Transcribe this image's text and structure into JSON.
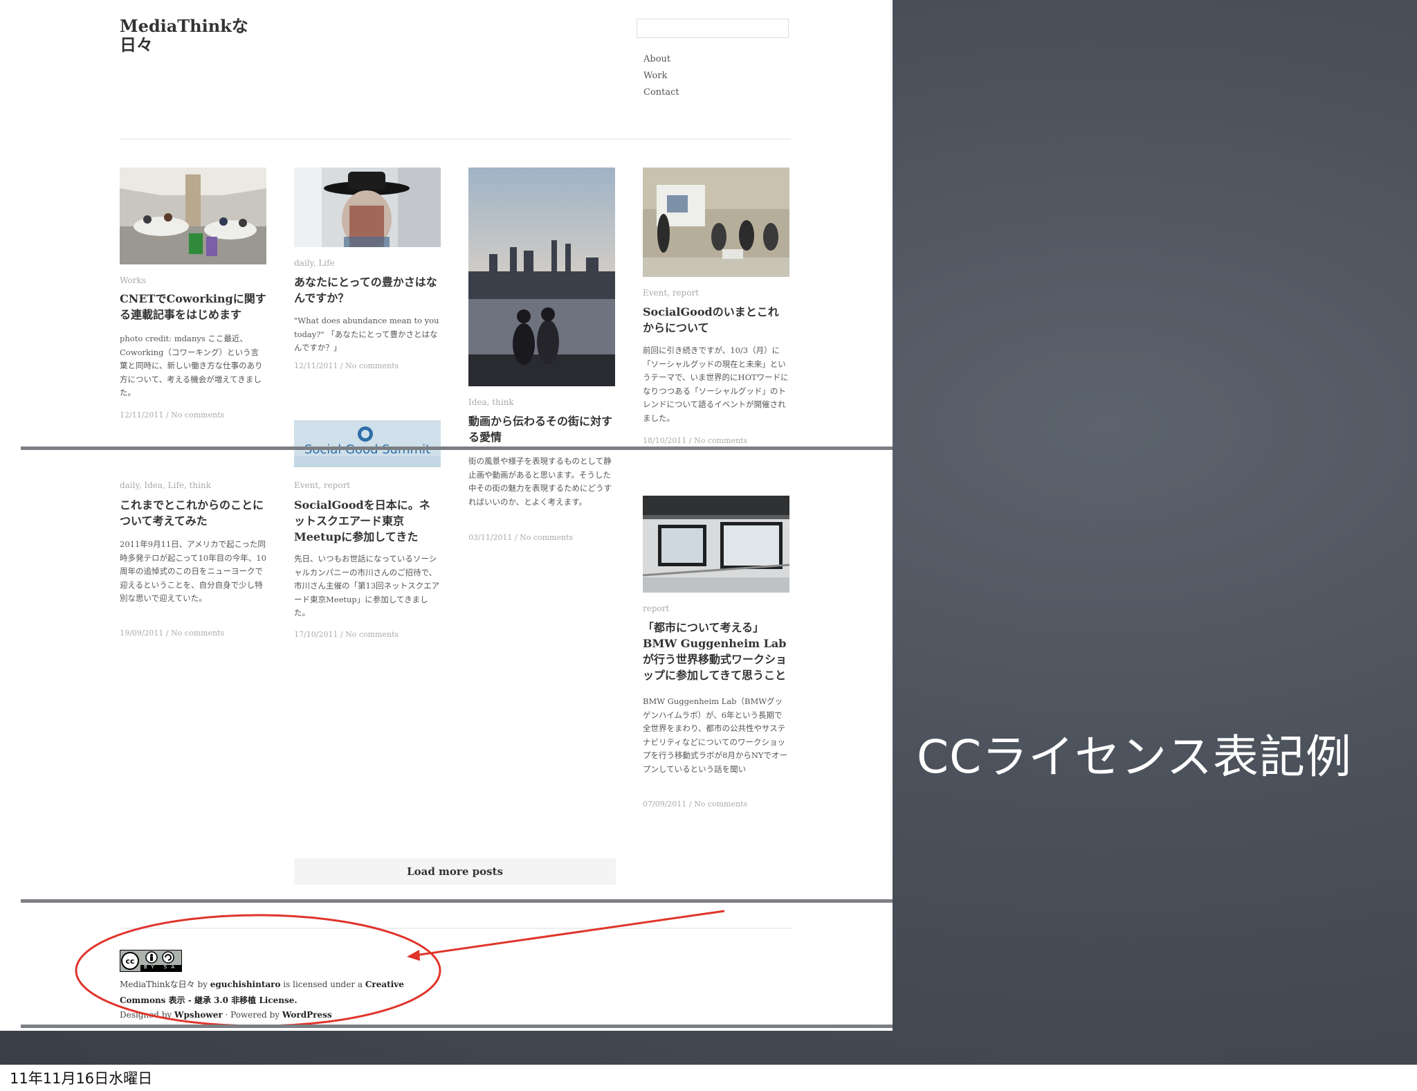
{
  "slide": {
    "title": "CCライセンス表記例",
    "date": "11年11月16日水曜日"
  },
  "site": {
    "title_line1": "MediaThinkな",
    "title_line2": "日々",
    "search_placeholder": "",
    "nav": [
      "About",
      "Work",
      "Contact"
    ]
  },
  "posts": [
    {
      "category": "Works",
      "title": "CNETでCoworkingに関する連載記事をはじめます",
      "excerpt": "photo credit: mdanys ここ最近、Coworking（コワーキング）という言葉と同時に、新しい働き方な仕事のあり方について、考える機会が増えてきました。",
      "meta": "12/11/2011 / No comments"
    },
    {
      "category": "daily, Life",
      "title": "あなたにとっての豊かさはなんですか？",
      "excerpt": "\"What does abundance mean to you today?\" 「あなたにとって豊かさとはなんですか？」",
      "meta": "12/11/2011 / No comments"
    },
    {
      "category": "Idea, think",
      "title": "動画から伝わるその街に対する愛情",
      "excerpt": "街の風景や様子を表現するものとして静止画や動画があると思います。そうした中その街の魅力を表現するためにどうすればいいのか、とよく考えます。",
      "meta": "03/11/2011 / No comments"
    },
    {
      "category": "Event, report",
      "title": "SocialGoodのいまとこれからについて",
      "excerpt": "前回に引き続きですが、10/3（月）に「ソーシャルグッドの現在と未来」というテーマで、いま世界的にHOTワードになりつつある「ソーシャルグッド」のトレンドについて語るイベントが開催されました。",
      "meta": "18/10/2011 / No comments"
    },
    {
      "category": "daily, Idea, Life, think",
      "title": "これまでとこれからのことについて考えてみた",
      "excerpt": "2011年9月11日、アメリカで起こった同時多発テロが起こって10年目の今年、10周年の追悼式のこの日をニューヨークで迎えるということを、自分自身で少し特別な思いで迎えていた。",
      "meta": "19/09/2011 / No comments"
    },
    {
      "category": "Event, report",
      "title": "SocialGoodを日本に。ネットスクエアード東京Meetupに参加してきた",
      "excerpt": "先日、いつもお世話になっているソーシャルカンパニーの市川さんのご招待で、市川さん主催の「第13回ネットスクエアード東京Meetup」に参加してきました。",
      "meta": "17/10/2011 / No comments",
      "image_text": "Social Good Summit"
    },
    {
      "category": "report",
      "title": "「都市について考える」BMW Guggenheim Labが行う世界移動式ワークショップに参加してきて思うこと",
      "excerpt": "BMW Guggenheim Lab（BMWグッゲンハイムラボ）が、6年という長期で全世界をまわり、都市の公共性やサステナビリティなどについてのワークショップを行う移動式ラボが8月からNYでオープンしているという話を聞い",
      "meta": "07/09/2011 / No comments"
    }
  ],
  "load_more": "Load more posts",
  "footer": {
    "license_line1_pre": "MediaThinkな日々 by ",
    "license_author": "eguchishintaro",
    "license_line1_mid": " is licensed under a ",
    "license_line1_link": "Creative",
    "license_line2": "Commons 表示 - 継承 3.0 非移植 License.",
    "designed_pre": "Designed by ",
    "designed_by": "Wpshower",
    "powered_pre": " · Powered by ",
    "powered_by": "WordPress",
    "cc_badge_text": "BY SA"
  },
  "colors": {
    "slide_bg": "#4a5059",
    "annotation": "#e0342b"
  }
}
